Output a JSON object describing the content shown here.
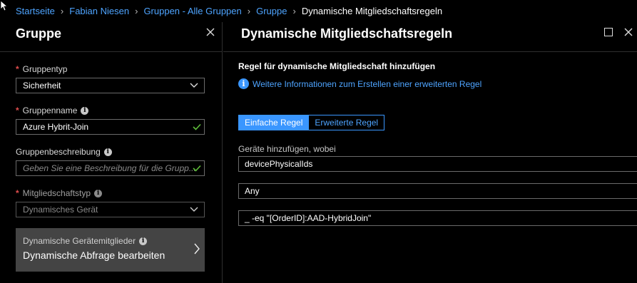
{
  "breadcrumb": {
    "items": [
      "Startseite",
      "Fabian Niesen",
      "Gruppen - Alle Gruppen",
      "Gruppe"
    ],
    "current": "Dynamische Mitgliedschaftsregeln"
  },
  "left_blade": {
    "title": "Gruppe",
    "group_type": {
      "label": "Gruppentyp",
      "value": "Sicherheit"
    },
    "group_name": {
      "label": "Gruppenname",
      "value": "Azure Hybrit-Join"
    },
    "description": {
      "label": "Gruppenbeschreibung",
      "placeholder": "Geben Sie eine Beschreibung für die Grupp..."
    },
    "membership_type": {
      "label": "Mitgliedschaftstyp",
      "value": "Dynamisches Gerät"
    },
    "dynamic_members": {
      "label": "Dynamische Gerätemitglieder",
      "value": "Dynamische Abfrage bearbeiten"
    }
  },
  "right_blade": {
    "title": "Dynamische Mitgliedschaftsregeln",
    "section_title": "Regel für dynamische Mitgliedschaft hinzufügen",
    "info_link": "Weitere Informationen zum Erstellen einer erweiterten Regel",
    "tabs": [
      "Einfache Regel",
      "Erweiterte Regel"
    ],
    "active_tab": "Einfache Regel",
    "devices_label": "Geräte hinzufügen, wobei",
    "property": "devicePhysicalIds",
    "operator": "Any",
    "expression": "_ -eq \"[OrderID]:AAD-HybridJoin\""
  },
  "colors": {
    "accent": "#3a96ff",
    "link": "#4ea4ff",
    "required": "#e04e4e",
    "valid": "#5fbf3a"
  }
}
